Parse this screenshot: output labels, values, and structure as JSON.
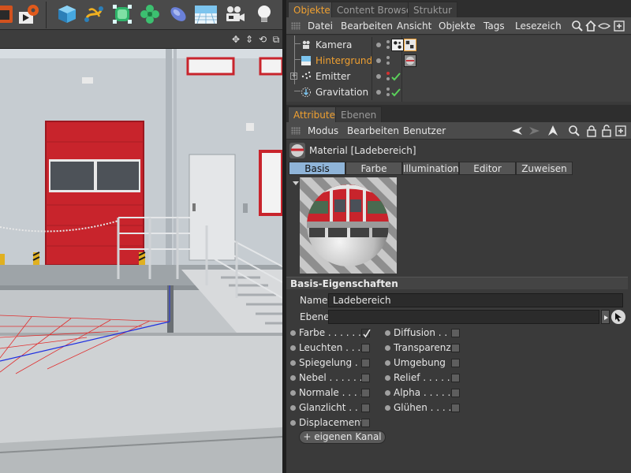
{
  "object_manager": {
    "tabs": [
      "Objekte",
      "Content Browser",
      "Struktur"
    ],
    "menu": [
      "Datei",
      "Bearbeiten",
      "Ansicht",
      "Objekte",
      "Tags",
      "Lesezeich"
    ],
    "objects": [
      {
        "name": "Kamera",
        "selected": false,
        "icon": "camera-icon"
      },
      {
        "name": "Hintergrund",
        "selected": true,
        "icon": "background-icon"
      },
      {
        "name": "Emitter",
        "selected": false,
        "icon": "emitter-icon"
      },
      {
        "name": "Gravitation",
        "selected": false,
        "icon": "gravity-icon"
      }
    ]
  },
  "attribute_manager": {
    "tabs": [
      "Attribute",
      "Ebenen"
    ],
    "menu": [
      "Modus",
      "Bearbeiten",
      "Benutzer"
    ],
    "title": "Material [Ladebereich]",
    "channel_tabs": [
      "Basis",
      "Farbe",
      "Illumination",
      "Editor",
      "Zuweisen"
    ],
    "active_channel": "Basis",
    "section_title": "Basis-Eigenschaften",
    "name_label": "Name",
    "name_value": "Ladebereich",
    "layer_label": "Ebene",
    "layer_value": "",
    "channels_left": [
      {
        "label": "Farbe . . . . . . .",
        "checked": true
      },
      {
        "label": "Leuchten . . . .",
        "checked": false
      },
      {
        "label": "Spiegelung . . .",
        "checked": false
      },
      {
        "label": "Nebel . . . . . . .",
        "checked": false
      },
      {
        "label": "Normale . . . .",
        "checked": false
      },
      {
        "label": "Glanzlicht . . .",
        "checked": false
      },
      {
        "label": "Displacement",
        "checked": false
      }
    ],
    "channels_right": [
      {
        "label": "Diffusion . . .",
        "checked": false
      },
      {
        "label": "Transparenz",
        "checked": false
      },
      {
        "label": "Umgebung",
        "checked": false
      },
      {
        "label": "Relief . . . . . .",
        "checked": false
      },
      {
        "label": "Alpha . . . . . .",
        "checked": false
      },
      {
        "label": "Glühen . . . . .",
        "checked": false
      }
    ],
    "add_channel_label": "+ eigenen Kanal"
  },
  "colors": {
    "accent_orange": "#f0a030",
    "active_tab_blue": "#8fb4d8",
    "door_red": "#c8242c"
  }
}
